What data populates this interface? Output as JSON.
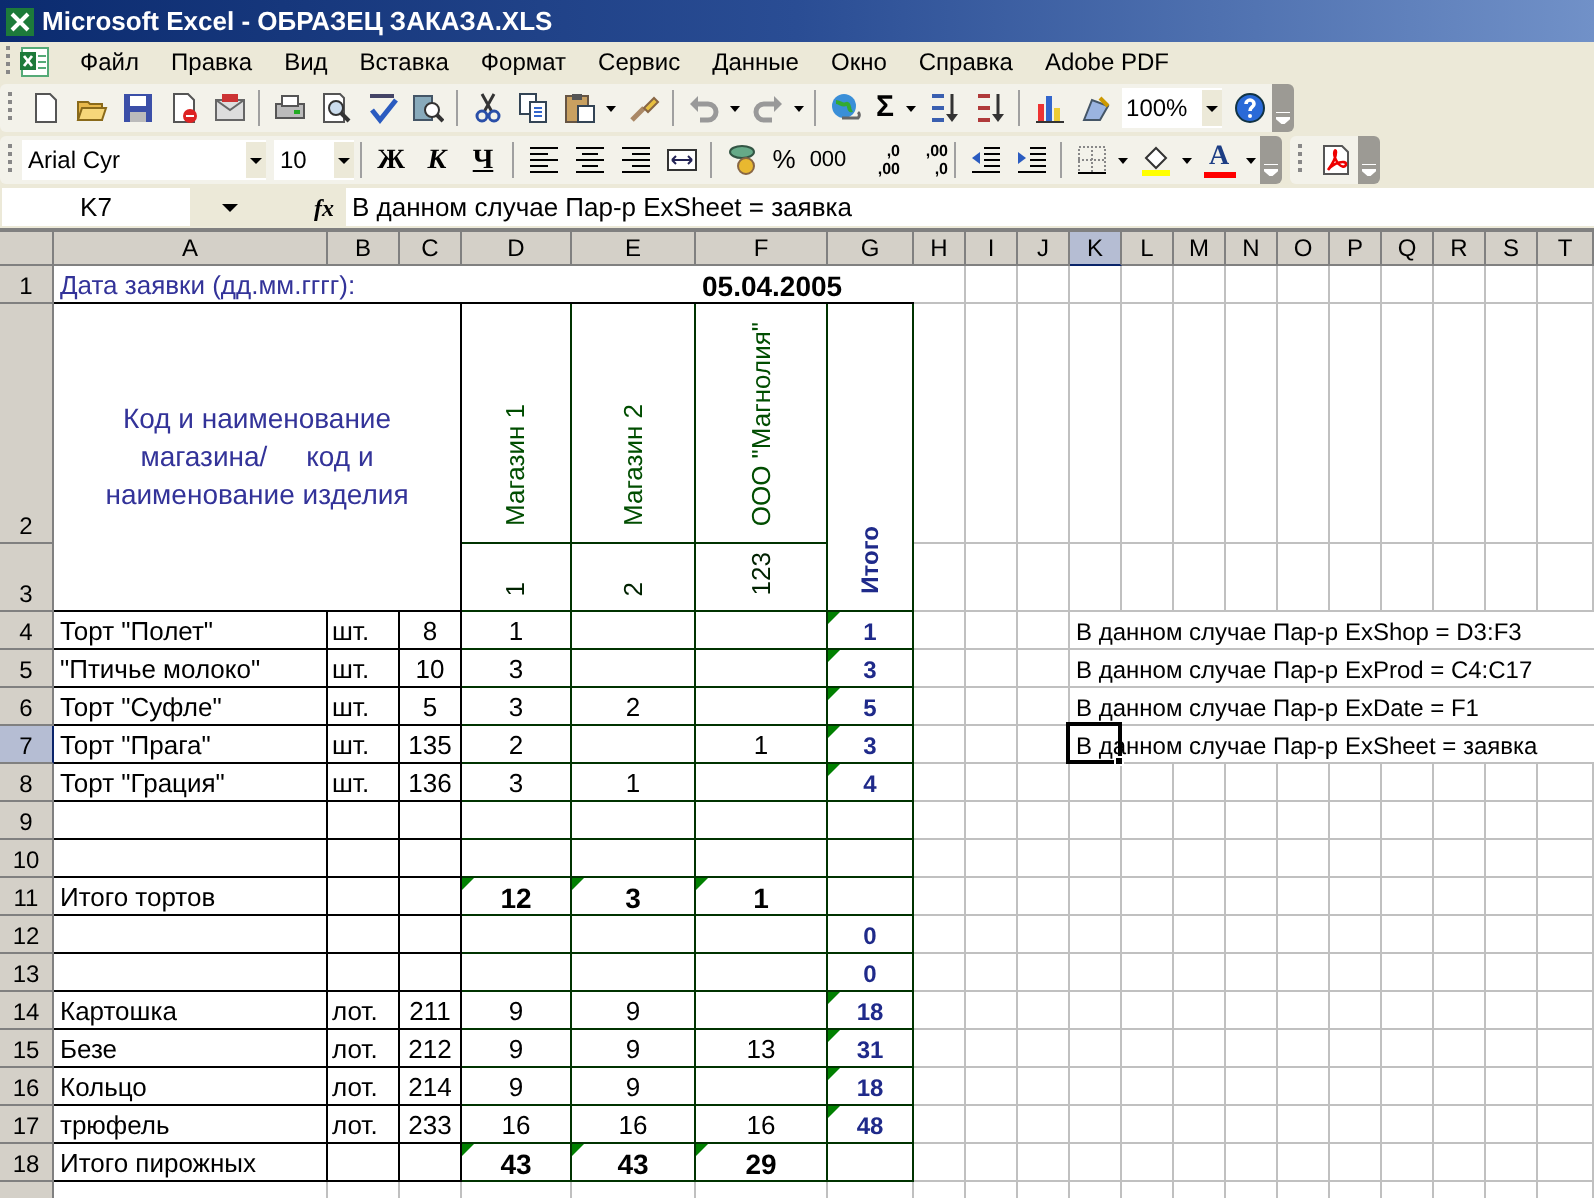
{
  "window": {
    "title": "Microsoft Excel - ОБРАЗЕЦ ЗАКАЗА.XLS"
  },
  "menu": [
    "Файл",
    "Правка",
    "Вид",
    "Вставка",
    "Формат",
    "Сервис",
    "Данные",
    "Окно",
    "Справка",
    "Adobe PDF"
  ],
  "standard_toolbar": {
    "autosum": "Σ",
    "zoom": "100%"
  },
  "formatting_toolbar": {
    "font": "Arial Cyr",
    "size": "10",
    "style_buttons": [
      "Ж",
      "К",
      "Ч"
    ],
    "number_buttons": [
      "%",
      "000"
    ],
    "decimal_buttons": [
      {
        "top": ",0",
        "bottom": ",00"
      },
      {
        "top": ",00",
        "bottom": ",0"
      }
    ],
    "font_color_button": "A"
  },
  "formula_bar": {
    "name_box": "K7",
    "function_label": "fx",
    "formula": "В данном случае Пар-р ExSheet = заявка"
  },
  "columns": [
    {
      "label": "A",
      "selected": false
    },
    {
      "label": "B",
      "selected": false
    },
    {
      "label": "C",
      "selected": false
    },
    {
      "label": "D",
      "selected": false
    },
    {
      "label": "E",
      "selected": false
    },
    {
      "label": "F",
      "selected": false
    },
    {
      "label": "G",
      "selected": false
    },
    {
      "label": "H",
      "selected": false
    },
    {
      "label": "I",
      "selected": false
    },
    {
      "label": "J",
      "selected": false
    },
    {
      "label": "K",
      "selected": true
    },
    {
      "label": "L",
      "selected": false
    },
    {
      "label": "M",
      "selected": false
    },
    {
      "label": "N",
      "selected": false
    },
    {
      "label": "O",
      "selected": false
    },
    {
      "label": "P",
      "selected": false
    },
    {
      "label": "Q",
      "selected": false
    },
    {
      "label": "R",
      "selected": false
    },
    {
      "label": "S",
      "selected": false
    },
    {
      "label": "T",
      "selected": false
    }
  ],
  "row_headers": [
    {
      "label": "1",
      "selected": false
    },
    {
      "label": "2",
      "selected": false
    },
    {
      "label": "3",
      "selected": false
    },
    {
      "label": "4",
      "selected": false
    },
    {
      "label": "5",
      "selected": false
    },
    {
      "label": "6",
      "selected": false
    },
    {
      "label": "7",
      "selected": true
    },
    {
      "label": "8",
      "selected": false
    },
    {
      "label": "9",
      "selected": false
    },
    {
      "label": "10",
      "selected": false
    },
    {
      "label": "11",
      "selected": false
    },
    {
      "label": "12",
      "selected": false
    },
    {
      "label": "13",
      "selected": false
    },
    {
      "label": "14",
      "selected": false
    },
    {
      "label": "15",
      "selected": false
    },
    {
      "label": "16",
      "selected": false
    },
    {
      "label": "17",
      "selected": false
    },
    {
      "label": "18",
      "selected": false
    }
  ],
  "sheet": {
    "date_label": "Дата заявки (дд.мм.гггг):",
    "date": "05.04.2005",
    "product_header": "Код и наименование магазина/     код и наименование изделия",
    "stores": [
      {
        "name": "Магазин 1",
        "code": "1"
      },
      {
        "name": "Магазин 2",
        "code": "2"
      },
      {
        "name": "ООО \"Магнолия\"",
        "code": "123"
      }
    ],
    "total_header": "Итого",
    "rows": [
      {
        "kind": "item",
        "name": "Торт \"Полет\"",
        "unit": "шт.",
        "code": "8",
        "qty": {
          "D": {
            "value": "1"
          }
        },
        "total": {
          "value": "1",
          "flag": true
        }
      },
      {
        "kind": "item",
        "name": "\"Птичье молоко\"",
        "unit": "шт.",
        "code": "10",
        "qty": {
          "D": {
            "value": "3"
          }
        },
        "total": {
          "value": "3",
          "flag": true
        }
      },
      {
        "kind": "item",
        "name": "Торт \"Суфле\"",
        "unit": "шт.",
        "code": "5",
        "qty": {
          "D": {
            "value": "3"
          },
          "E": {
            "value": "2"
          }
        },
        "total": {
          "value": "5",
          "flag": true
        }
      },
      {
        "kind": "item",
        "name": "Торт \"Прага\"",
        "unit": "шт.",
        "code": "135",
        "qty": {
          "D": {
            "value": "2"
          },
          "F": {
            "value": "1"
          }
        },
        "total": {
          "value": "3",
          "flag": true
        }
      },
      {
        "kind": "item",
        "name": "Торт \"Грация\"",
        "unit": "шт.",
        "code": "136",
        "qty": {
          "D": {
            "value": "3"
          },
          "E": {
            "value": "1"
          }
        },
        "total": {
          "value": "4",
          "flag": true
        }
      },
      {
        "kind": "blank"
      },
      {
        "kind": "blank"
      },
      {
        "kind": "subtotal",
        "name": "Итого тортов",
        "qty": {
          "D": {
            "value": "12",
            "flag": true
          },
          "E": {
            "value": "3",
            "flag": true
          },
          "F": {
            "value": "1",
            "flag": true
          }
        }
      },
      {
        "kind": "blank",
        "total": {
          "value": "0"
        }
      },
      {
        "kind": "blank",
        "total": {
          "value": "0"
        }
      },
      {
        "kind": "item",
        "name": "Картошка",
        "unit": "лот.",
        "code": "211",
        "qty": {
          "D": {
            "value": "9"
          },
          "E": {
            "value": "9"
          }
        },
        "total": {
          "value": "18",
          "flag": true
        }
      },
      {
        "kind": "item",
        "name": "Безе",
        "unit": "лот.",
        "code": "212",
        "qty": {
          "D": {
            "value": "9"
          },
          "E": {
            "value": "9"
          },
          "F": {
            "value": "13"
          }
        },
        "total": {
          "value": "31",
          "flag": true
        }
      },
      {
        "kind": "item",
        "name": "Кольцо",
        "unit": "лот.",
        "code": "214",
        "qty": {
          "D": {
            "value": "9"
          },
          "E": {
            "value": "9"
          }
        },
        "total": {
          "value": "18",
          "flag": true
        }
      },
      {
        "kind": "item",
        "name": "трюфель",
        "unit": "лот.",
        "code": "233",
        "qty": {
          "D": {
            "value": "16"
          },
          "E": {
            "value": "16"
          },
          "F": {
            "value": "16"
          }
        },
        "total": {
          "value": "48",
          "flag": true
        }
      },
      {
        "kind": "subtotal",
        "name": "Итого пирожных",
        "qty": {
          "D": {
            "value": "43",
            "flag": true
          },
          "E": {
            "value": "43",
            "flag": true
          },
          "F": {
            "value": "29",
            "flag": true
          }
        }
      }
    ],
    "notes": [
      {
        "text": "В данном случае Пар-р ExShop = D3:F3",
        "active": false
      },
      {
        "text": "В данном случае Пар-р ExProd = C4:C17",
        "active": false
      },
      {
        "text": "В данном случае Пар-р ExDate = F1",
        "active": false
      },
      {
        "text": "В данном случае Пар-р ExSheet = заявка",
        "active": true
      }
    ]
  }
}
